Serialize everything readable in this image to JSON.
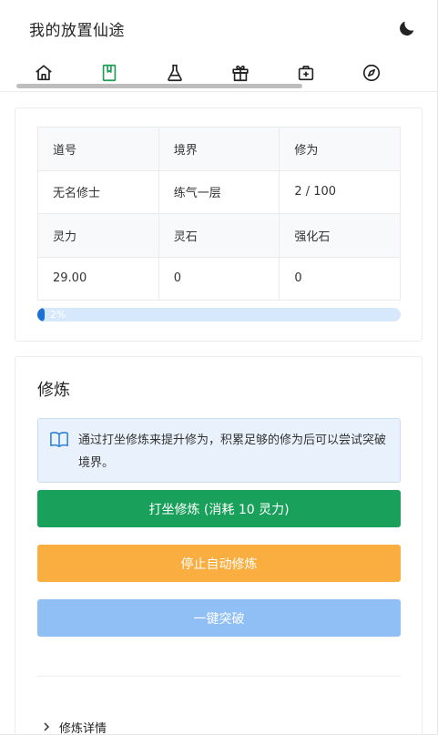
{
  "app": {
    "title": "我的放置仙途"
  },
  "header": {
    "theme_icon": "moon-icon",
    "tabs": [
      {
        "icon": "home-icon",
        "active": false
      },
      {
        "icon": "book-icon",
        "active": true
      },
      {
        "icon": "flask-icon",
        "active": false
      },
      {
        "icon": "gift-icon",
        "active": false
      },
      {
        "icon": "medkit-icon",
        "active": false
      },
      {
        "icon": "compass-icon",
        "active": false
      }
    ]
  },
  "stats": {
    "rows": [
      [
        "道号",
        "境界",
        "修为"
      ],
      [
        "无名修士",
        "练气一层",
        "2 / 100"
      ],
      [
        "灵力",
        "灵石",
        "强化石"
      ],
      [
        "29.00",
        "0",
        "0"
      ]
    ],
    "progress": {
      "percent": 2,
      "label": "2%"
    }
  },
  "training": {
    "title": "修炼",
    "info_icon": "book-open-icon",
    "info_text": "通过打坐修炼来提升修为，积累足够的修为后可以尝试突破境界。",
    "meditate_label": "打坐修炼 (消耗 10 灵力)",
    "stop_auto_label": "停止自动修炼",
    "breakthrough_label": "一键突破",
    "details_label": "修炼详情"
  },
  "colors": {
    "accent_green": "#19a05a",
    "warning_orange": "#f9ae3f",
    "primary_blue_light": "#8fbff5",
    "progress_blue": "#1a6fd9",
    "active_tab": "#1f9d55"
  }
}
